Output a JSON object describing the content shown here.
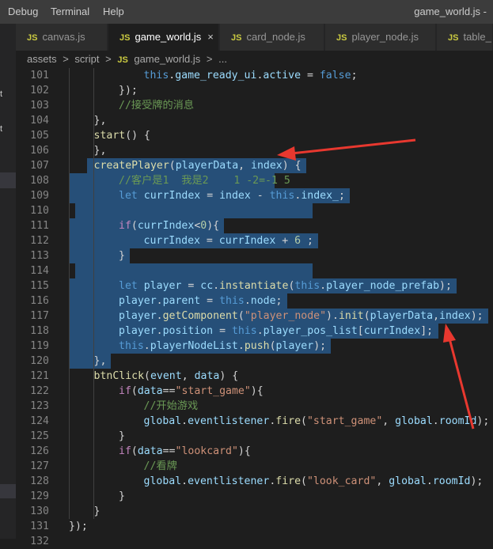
{
  "menu": [
    "Debug",
    "Terminal",
    "Help"
  ],
  "window_title": "game_world.js -",
  "sidebar_fragments": [
    "t",
    "t"
  ],
  "tabs": [
    {
      "label": "canvas.js",
      "active": false
    },
    {
      "label": "game_world.js",
      "active": true
    },
    {
      "label": "card_node.js",
      "active": false
    },
    {
      "label": "player_node.js",
      "active": false
    },
    {
      "label": "table_",
      "active": false
    }
  ],
  "tab_icon_text": "JS",
  "close_glyph": "×",
  "breadcrumb": [
    "assets",
    ">",
    "script",
    ">",
    "JS",
    "game_world.js",
    ">",
    "..."
  ],
  "code_lines": [
    {
      "n": "101",
      "t": [
        [
          "k",
          "this"
        ],
        [
          "p",
          "."
        ],
        [
          "v",
          "game_ready_ui"
        ],
        [
          "p",
          "."
        ],
        [
          "v",
          "active"
        ],
        [
          "p",
          " = "
        ],
        [
          "k",
          "false"
        ],
        [
          "p",
          ";"
        ]
      ],
      "indent": 3
    },
    {
      "n": "102",
      "t": [
        [
          "p",
          "});"
        ]
      ],
      "indent": 2
    },
    {
      "n": "103",
      "t": [
        [
          "c",
          "//接受牌的消息"
        ]
      ],
      "indent": 2
    },
    {
      "n": "104",
      "t": [
        [
          "p",
          "},"
        ]
      ],
      "indent": 1
    },
    {
      "n": "105",
      "t": [
        [
          "f",
          "start"
        ],
        [
          "p",
          "() {"
        ]
      ],
      "indent": 1
    },
    {
      "n": "106",
      "t": [
        [
          "p",
          "},"
        ]
      ],
      "indent": 1
    },
    {
      "n": "107",
      "t": [
        [
          "f",
          "createPlayer"
        ],
        [
          "p",
          "("
        ],
        [
          "v",
          "playerData"
        ],
        [
          "p",
          ", "
        ],
        [
          "v",
          "index"
        ],
        [
          "p",
          ") {"
        ]
      ],
      "indent": 1
    },
    {
      "n": "108",
      "t": [
        [
          "c",
          "//客户是1  我是2    1 -2=-1 5"
        ]
      ],
      "indent": 2
    },
    {
      "n": "109",
      "t": [
        [
          "k",
          "let"
        ],
        [
          "p",
          " "
        ],
        [
          "v",
          "currIndex"
        ],
        [
          "p",
          " = "
        ],
        [
          "v",
          "index"
        ],
        [
          "p",
          " - "
        ],
        [
          "k",
          "this"
        ],
        [
          "p",
          "."
        ],
        [
          "v",
          "index_"
        ],
        [
          "p",
          ";"
        ]
      ],
      "indent": 2
    },
    {
      "n": "110",
      "t": [],
      "indent": 0
    },
    {
      "n": "111",
      "t": [
        [
          "kw",
          "if"
        ],
        [
          "p",
          "("
        ],
        [
          "v",
          "currIndex"
        ],
        [
          "p",
          "<"
        ],
        [
          "n",
          "0"
        ],
        [
          "p",
          "){"
        ]
      ],
      "indent": 2
    },
    {
      "n": "112",
      "t": [
        [
          "v",
          "currIndex"
        ],
        [
          "p",
          " = "
        ],
        [
          "v",
          "currIndex"
        ],
        [
          "p",
          " + "
        ],
        [
          "n",
          "6"
        ],
        [
          "p",
          " ;"
        ]
      ],
      "indent": 3
    },
    {
      "n": "113",
      "t": [
        [
          "p",
          "}"
        ]
      ],
      "indent": 2
    },
    {
      "n": "114",
      "t": [],
      "indent": 0
    },
    {
      "n": "115",
      "t": [
        [
          "k",
          "let"
        ],
        [
          "p",
          " "
        ],
        [
          "v",
          "player"
        ],
        [
          "p",
          " = "
        ],
        [
          "v",
          "cc"
        ],
        [
          "p",
          "."
        ],
        [
          "f",
          "instantiate"
        ],
        [
          "p",
          "("
        ],
        [
          "k",
          "this"
        ],
        [
          "p",
          "."
        ],
        [
          "v",
          "player_node_prefab"
        ],
        [
          "p",
          ");"
        ]
      ],
      "indent": 2
    },
    {
      "n": "116",
      "t": [
        [
          "v",
          "player"
        ],
        [
          "p",
          "."
        ],
        [
          "v",
          "parent"
        ],
        [
          "p",
          " = "
        ],
        [
          "k",
          "this"
        ],
        [
          "p",
          "."
        ],
        [
          "v",
          "node"
        ],
        [
          "p",
          ";"
        ]
      ],
      "indent": 2
    },
    {
      "n": "117",
      "t": [
        [
          "v",
          "player"
        ],
        [
          "p",
          "."
        ],
        [
          "f",
          "getComponent"
        ],
        [
          "p",
          "("
        ],
        [
          "s",
          "\"player_node\""
        ],
        [
          "p",
          ")."
        ],
        [
          "f",
          "init"
        ],
        [
          "p",
          "("
        ],
        [
          "v",
          "playerData"
        ],
        [
          "p",
          ","
        ],
        [
          "v",
          "index"
        ],
        [
          "p",
          ");"
        ]
      ],
      "indent": 2
    },
    {
      "n": "118",
      "t": [
        [
          "v",
          "player"
        ],
        [
          "p",
          "."
        ],
        [
          "v",
          "position"
        ],
        [
          "p",
          " = "
        ],
        [
          "k",
          "this"
        ],
        [
          "p",
          "."
        ],
        [
          "v",
          "player_pos_list"
        ],
        [
          "p",
          "["
        ],
        [
          "v",
          "currIndex"
        ],
        [
          "p",
          "];"
        ]
      ],
      "indent": 2
    },
    {
      "n": "119",
      "t": [
        [
          "k",
          "this"
        ],
        [
          "p",
          "."
        ],
        [
          "v",
          "playerNodeList"
        ],
        [
          "p",
          "."
        ],
        [
          "f",
          "push"
        ],
        [
          "p",
          "("
        ],
        [
          "v",
          "player"
        ],
        [
          "p",
          ");"
        ]
      ],
      "indent": 2
    },
    {
      "n": "120",
      "t": [
        [
          "p",
          "},"
        ]
      ],
      "indent": 1
    },
    {
      "n": "121",
      "t": [
        [
          "f",
          "btnClick"
        ],
        [
          "p",
          "("
        ],
        [
          "v",
          "event"
        ],
        [
          "p",
          ", "
        ],
        [
          "v",
          "data"
        ],
        [
          "p",
          ") {"
        ]
      ],
      "indent": 1
    },
    {
      "n": "122",
      "t": [
        [
          "kw",
          "if"
        ],
        [
          "p",
          "("
        ],
        [
          "v",
          "data"
        ],
        [
          "p",
          "=="
        ],
        [
          "s",
          "\"start_game\""
        ],
        [
          "p",
          "){"
        ]
      ],
      "indent": 2
    },
    {
      "n": "123",
      "t": [
        [
          "c",
          "//开始游戏"
        ]
      ],
      "indent": 3
    },
    {
      "n": "124",
      "t": [
        [
          "v",
          "global"
        ],
        [
          "p",
          "."
        ],
        [
          "v",
          "eventlistener"
        ],
        [
          "p",
          "."
        ],
        [
          "f",
          "fire"
        ],
        [
          "p",
          "("
        ],
        [
          "s",
          "\"start_game\""
        ],
        [
          "p",
          ", "
        ],
        [
          "v",
          "global"
        ],
        [
          "p",
          "."
        ],
        [
          "v",
          "roomId"
        ],
        [
          "p",
          ");"
        ]
      ],
      "indent": 3
    },
    {
      "n": "125",
      "t": [
        [
          "p",
          "}"
        ]
      ],
      "indent": 2
    },
    {
      "n": "126",
      "t": [
        [
          "kw",
          "if"
        ],
        [
          "p",
          "("
        ],
        [
          "v",
          "data"
        ],
        [
          "p",
          "=="
        ],
        [
          "s",
          "\"lookcard\""
        ],
        [
          "p",
          "){"
        ]
      ],
      "indent": 2
    },
    {
      "n": "127",
      "t": [
        [
          "c",
          "//看牌"
        ]
      ],
      "indent": 3
    },
    {
      "n": "128",
      "t": [
        [
          "v",
          "global"
        ],
        [
          "p",
          "."
        ],
        [
          "v",
          "eventlistener"
        ],
        [
          "p",
          "."
        ],
        [
          "f",
          "fire"
        ],
        [
          "p",
          "("
        ],
        [
          "s",
          "\"look_card\""
        ],
        [
          "p",
          ", "
        ],
        [
          "v",
          "global"
        ],
        [
          "p",
          "."
        ],
        [
          "v",
          "roomId"
        ],
        [
          "p",
          ");"
        ]
      ],
      "indent": 3
    },
    {
      "n": "129",
      "t": [
        [
          "p",
          "}"
        ]
      ],
      "indent": 2
    },
    {
      "n": "130",
      "t": [
        [
          "p",
          "}"
        ]
      ],
      "indent": 1
    },
    {
      "n": "131",
      "t": [
        [
          "p",
          "});"
        ]
      ],
      "indent": 0
    },
    {
      "n": "132",
      "t": [],
      "indent": 0
    }
  ],
  "colors": {
    "selection": "#264f78",
    "arrow": "#e8382f",
    "background": "#1e1e1e"
  }
}
